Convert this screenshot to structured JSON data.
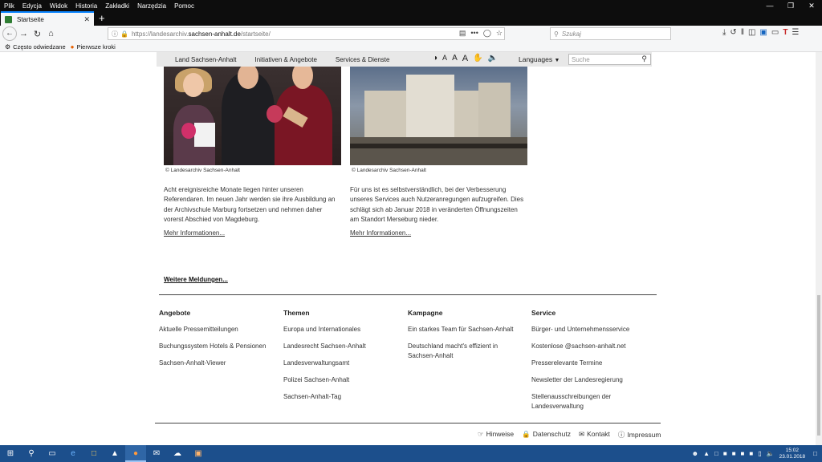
{
  "menu": {
    "items": [
      "Plik",
      "Edycja",
      "Widok",
      "Historia",
      "Zakładki",
      "Narzędzia",
      "Pomoc"
    ]
  },
  "tab": {
    "title": "Startseite"
  },
  "address": {
    "prefix": "https://landesarchiv.",
    "domain": "sachsen-anhalt.de",
    "path": "/startseite/",
    "search_placeholder": "Szukaj"
  },
  "bookmarks": {
    "items": [
      {
        "label": "Często odwiedzane",
        "icon": "gear-icon"
      },
      {
        "label": "Pierwsze kroki",
        "icon": "firefox-icon"
      }
    ]
  },
  "sitenav": {
    "items": [
      "Land Sachsen-Anhalt",
      "Initiativen & Angebote",
      "Services & Dienste"
    ],
    "languages_label": "Languages",
    "search_placeholder": "Suche"
  },
  "news": [
    {
      "caption": "© Landesarchiv Sachsen-Anhalt",
      "text": "Acht ereignisreiche Monate liegen hinter unseren Referendaren. Im neuen Jahr werden sie ihre Ausbildung an der Archivschule Marburg fortsetzen und nehmen daher vorerst Abschied von Magdeburg.",
      "more": "Mehr Informationen..."
    },
    {
      "caption": "© Landesarchiv Sachsen-Anhalt",
      "text": "Für uns ist es selbstverständlich, bei der Verbesserung unseres Services auch Nutzeranregungen aufzugreifen. Dies schlägt sich ab Januar 2018 in veränderten Öffnungszeiten am Standort Merseburg nieder.",
      "more": "Mehr Informationen..."
    }
  ],
  "weitere": "Weitere Meldungen...",
  "footer": {
    "columns": [
      {
        "heading": "Angebote",
        "links": [
          "Aktuelle Pressemitteilungen",
          "Buchungssystem Hotels & Pensionen",
          "Sachsen-Anhalt-Viewer"
        ]
      },
      {
        "heading": "Themen",
        "links": [
          "Europa und Internationales",
          "Landesrecht Sachsen-Anhalt",
          "Landesverwaltungsamt",
          "Polizei Sachsen-Anhalt",
          "Sachsen-Anhalt-Tag"
        ]
      },
      {
        "heading": "Kampagne",
        "links": [
          "Ein starkes Team für Sachsen-Anhalt",
          "Deutschland macht's effizient in Sachsen-Anhalt"
        ]
      },
      {
        "heading": "Service",
        "links": [
          "Bürger- und Unternehmensservice",
          "Kostenlose @sachsen-anhalt.net",
          "Presserelevante Termine",
          "Newsletter der Landesregierung",
          "Stellenausschreibungen der Landesverwaltung"
        ]
      }
    ],
    "bottom_links": [
      "Hinweise",
      "Datenschutz",
      "Kontakt",
      "Impressum"
    ]
  },
  "taskbar": {
    "time": "15:02",
    "date": "23.01.2018"
  }
}
